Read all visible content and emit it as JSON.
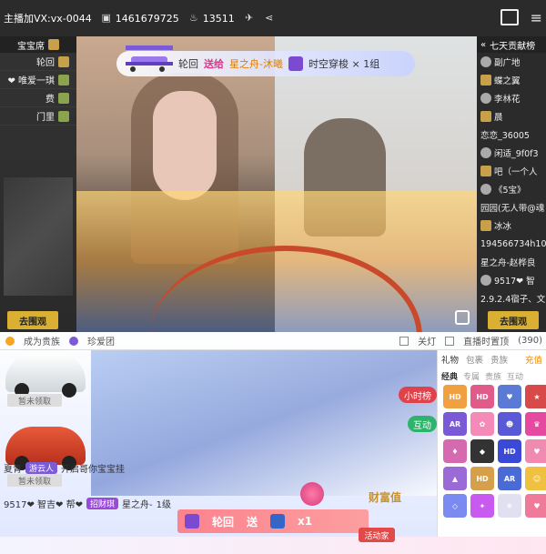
{
  "topbar": {
    "host_label": "主播加VX:vx-0044",
    "room_id": "1461679725",
    "hot": "13511"
  },
  "left_panel": {
    "title": "宝宝席",
    "items": [
      {
        "name": "轮回"
      },
      {
        "name": "❤ 唯爱一琪"
      },
      {
        "name": "费"
      },
      {
        "name": "门里"
      }
    ],
    "watch_button": "去围观"
  },
  "right_panel": {
    "title": "七天贡献榜",
    "items": [
      {
        "name": "副广地"
      },
      {
        "name": "蝶之翼"
      },
      {
        "name": "李林花"
      },
      {
        "name": "晨"
      },
      {
        "name": "恋恋_36005"
      },
      {
        "name": "闲适_9f0f3"
      },
      {
        "name": "吧（一个人"
      },
      {
        "name": "《5宝》"
      },
      {
        "name": "园园(无人带@魂"
      },
      {
        "name": "冰冰"
      },
      {
        "name": "194566734h106"
      },
      {
        "name": "星之舟-赵桦良"
      },
      {
        "name": "9517❤ 智"
      },
      {
        "name": "2.9.2.4宿子、文"
      }
    ],
    "watch_button": "去围观"
  },
  "banner": {
    "sender": "轮回",
    "verb": "送给",
    "receiver": "星之舟-沐曦",
    "gift": "时空穿梭 × 1组"
  },
  "bottom_bar": {
    "become_noble": "成为贵族",
    "guard": "珍爱团",
    "lights_off": "关灯",
    "auto_top": "直播时置顶",
    "auto_top_count": "(390)"
  },
  "cars": {
    "label1": "暂未领取",
    "label2": "暂未领取"
  },
  "overlay": {
    "pill1": "小时榜",
    "pill2": "互动"
  },
  "chat": {
    "line1_user": "夏青",
    "line1_badge": "游云人",
    "line1_text": "开启哥你宝宝挂",
    "line2_user": "9517❤ 智吉❤ 帮❤",
    "line2_badge": "招财琪",
    "line2_user2": "星之舟-",
    "line2_tail": "1级"
  },
  "gifts_panel": {
    "tabs": [
      "礼物",
      "包裹",
      "贵族"
    ],
    "top_up": "充值",
    "sub_tabs": [
      "经典",
      "专属",
      "贵族",
      "互动"
    ]
  },
  "gift_toast": {
    "sender": "轮回",
    "verb": "送",
    "count": "x1"
  },
  "gold_button": "财富值",
  "activity": "活动家"
}
